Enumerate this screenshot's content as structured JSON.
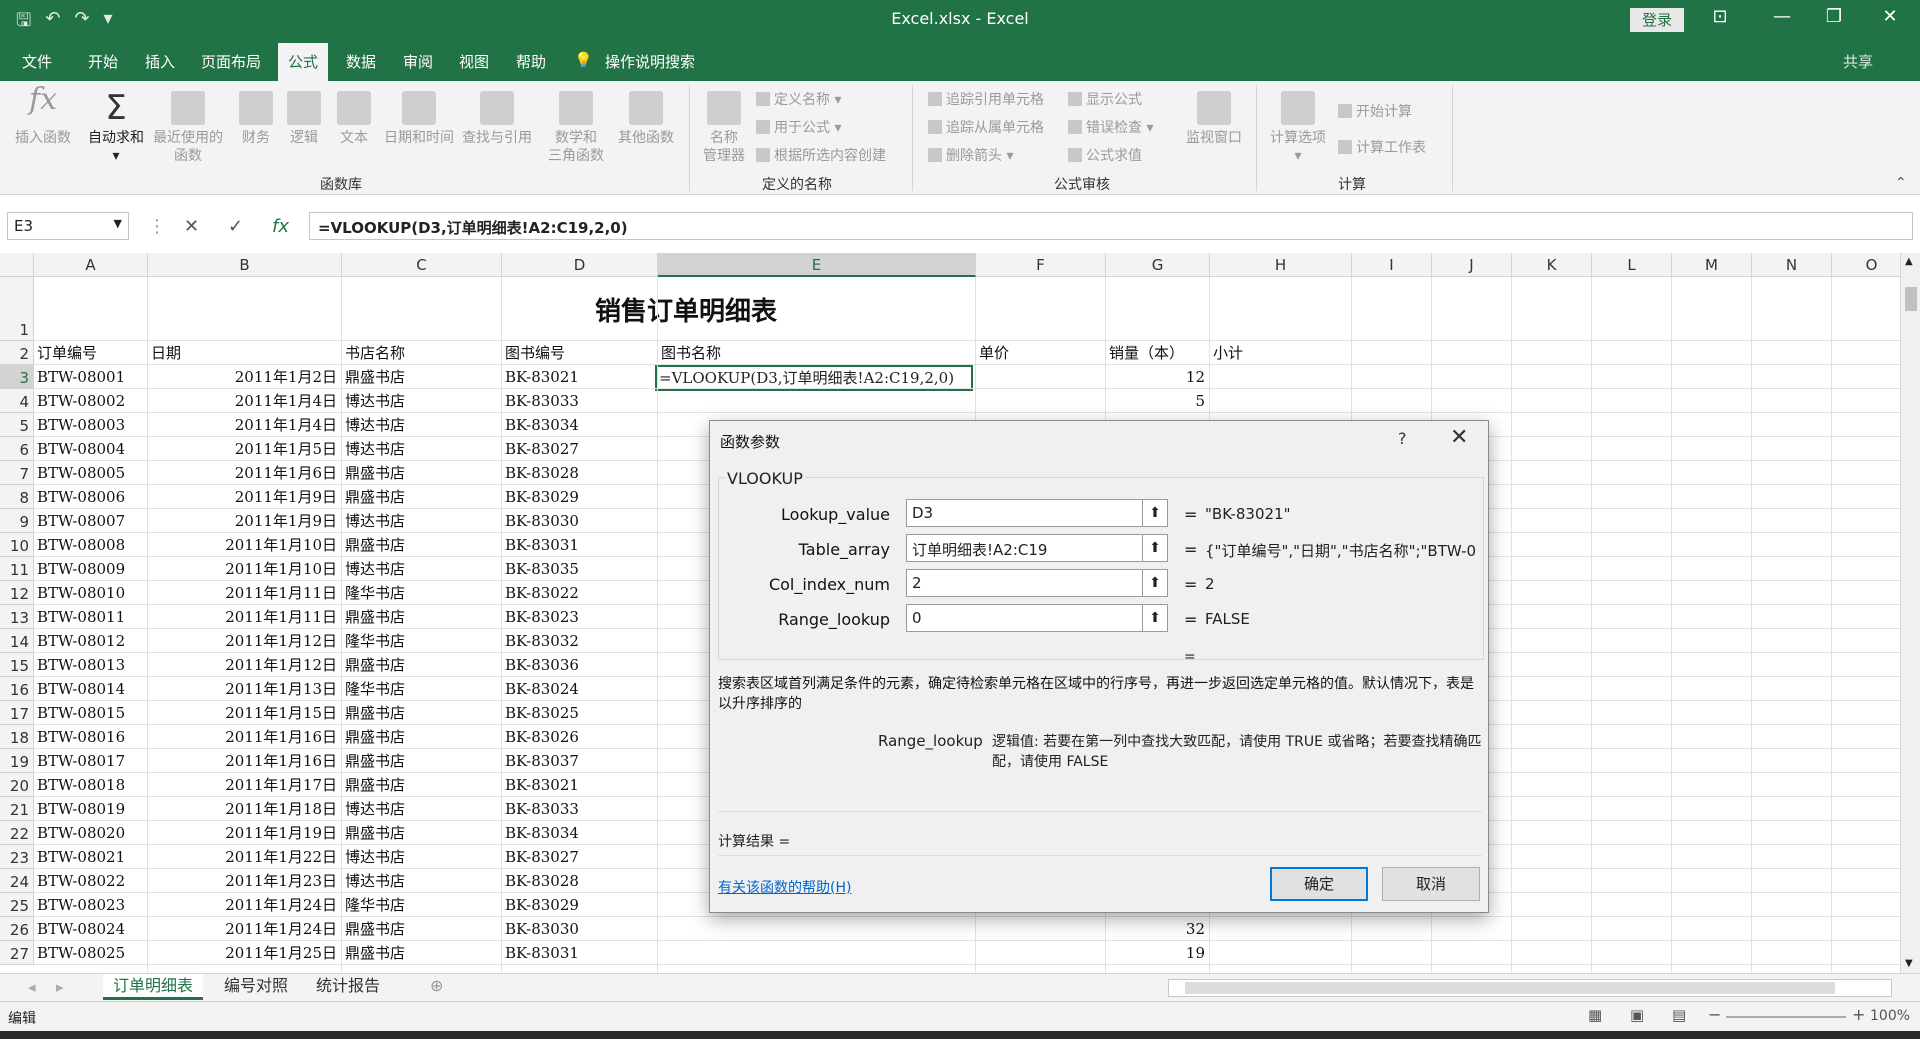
{
  "window": {
    "title": "Excel.xlsx - Excel",
    "login": "登录"
  },
  "tabs": [
    "文件",
    "开始",
    "插入",
    "页面布局",
    "公式",
    "数据",
    "审阅",
    "视图",
    "帮助",
    "操作说明搜索"
  ],
  "share": "共享",
  "ribbon": {
    "insert_fn": "插入函数",
    "autosum": "自动求和",
    "recent": "最近使用的\n函数",
    "finance": "财务",
    "logic": "逻辑",
    "text": "文本",
    "datetime": "日期和时间",
    "lookup": "查找与引用",
    "math": "数学和\n三角函数",
    "more": "其他函数",
    "group_fnlib": "函数库",
    "name_mgr": "名称\n管理器",
    "define_name": "定义名称",
    "use_in_formula": "用于公式",
    "create_from_sel": "根据所选内容创建",
    "group_names": "定义的名称",
    "trace_prec": "追踪引用单元格",
    "trace_dep": "追踪从属单元格",
    "remove_arrows": "删除箭头",
    "show_formulas": "显示公式",
    "error_check": "错误检查",
    "eval_formula": "公式求值",
    "watch": "监视窗口",
    "group_audit": "公式审核",
    "calc_opts": "计算选项",
    "calc_now": "开始计算",
    "calc_sheet": "计算工作表",
    "group_calc": "计算"
  },
  "formula_bar": {
    "name_box": "E3",
    "formula": "=VLOOKUP(D3,订单明细表!A2:C19,2,0)"
  },
  "columns": [
    "A",
    "B",
    "C",
    "D",
    "E",
    "F",
    "G",
    "H",
    "I",
    "J",
    "K",
    "L",
    "M",
    "N",
    "O"
  ],
  "sheet_title": "销售订单明细表",
  "headers": [
    "订单编号",
    "日期",
    "书店名称",
    "图书编号",
    "图书名称",
    "单价",
    "销量（本）",
    "小计"
  ],
  "active_cell_text": "=VLOOKUP(D3,订单明细表!A2:C19,2,0)",
  "rows": [
    {
      "n": "3",
      "a": "BTW-08001",
      "b": "2011年1月2日",
      "c": "鼎盛书店",
      "d": "BK-83021",
      "g": "12"
    },
    {
      "n": "4",
      "a": "BTW-08002",
      "b": "2011年1月4日",
      "c": "博达书店",
      "d": "BK-83033",
      "g": "5"
    },
    {
      "n": "5",
      "a": "BTW-08003",
      "b": "2011年1月4日",
      "c": "博达书店",
      "d": "BK-83034",
      "g": ""
    },
    {
      "n": "6",
      "a": "BTW-08004",
      "b": "2011年1月5日",
      "c": "博达书店",
      "d": "BK-83027",
      "g": ""
    },
    {
      "n": "7",
      "a": "BTW-08005",
      "b": "2011年1月6日",
      "c": "鼎盛书店",
      "d": "BK-83028",
      "g": ""
    },
    {
      "n": "8",
      "a": "BTW-08006",
      "b": "2011年1月9日",
      "c": "鼎盛书店",
      "d": "BK-83029",
      "g": ""
    },
    {
      "n": "9",
      "a": "BTW-08007",
      "b": "2011年1月9日",
      "c": "博达书店",
      "d": "BK-83030",
      "g": ""
    },
    {
      "n": "10",
      "a": "BTW-08008",
      "b": "2011年1月10日",
      "c": "鼎盛书店",
      "d": "BK-83031",
      "g": ""
    },
    {
      "n": "11",
      "a": "BTW-08009",
      "b": "2011年1月10日",
      "c": "博达书店",
      "d": "BK-83035",
      "g": ""
    },
    {
      "n": "12",
      "a": "BTW-08010",
      "b": "2011年1月11日",
      "c": "隆华书店",
      "d": "BK-83022",
      "g": ""
    },
    {
      "n": "13",
      "a": "BTW-08011",
      "b": "2011年1月11日",
      "c": "鼎盛书店",
      "d": "BK-83023",
      "g": ""
    },
    {
      "n": "14",
      "a": "BTW-08012",
      "b": "2011年1月12日",
      "c": "隆华书店",
      "d": "BK-83032",
      "g": ""
    },
    {
      "n": "15",
      "a": "BTW-08013",
      "b": "2011年1月12日",
      "c": "鼎盛书店",
      "d": "BK-83036",
      "g": ""
    },
    {
      "n": "16",
      "a": "BTW-08014",
      "b": "2011年1月13日",
      "c": "隆华书店",
      "d": "BK-83024",
      "g": ""
    },
    {
      "n": "17",
      "a": "BTW-08015",
      "b": "2011年1月15日",
      "c": "鼎盛书店",
      "d": "BK-83025",
      "g": ""
    },
    {
      "n": "18",
      "a": "BTW-08016",
      "b": "2011年1月16日",
      "c": "鼎盛书店",
      "d": "BK-83026",
      "g": ""
    },
    {
      "n": "19",
      "a": "BTW-08017",
      "b": "2011年1月16日",
      "c": "鼎盛书店",
      "d": "BK-83037",
      "g": ""
    },
    {
      "n": "20",
      "a": "BTW-08018",
      "b": "2011年1月17日",
      "c": "鼎盛书店",
      "d": "BK-83021",
      "g": ""
    },
    {
      "n": "21",
      "a": "BTW-08019",
      "b": "2011年1月18日",
      "c": "博达书店",
      "d": "BK-83033",
      "g": ""
    },
    {
      "n": "22",
      "a": "BTW-08020",
      "b": "2011年1月19日",
      "c": "鼎盛书店",
      "d": "BK-83034",
      "g": ""
    },
    {
      "n": "23",
      "a": "BTW-08021",
      "b": "2011年1月22日",
      "c": "博达书店",
      "d": "BK-83027",
      "g": ""
    },
    {
      "n": "24",
      "a": "BTW-08022",
      "b": "2011年1月23日",
      "c": "博达书店",
      "d": "BK-83028",
      "g": ""
    },
    {
      "n": "25",
      "a": "BTW-08023",
      "b": "2011年1月24日",
      "c": "隆华书店",
      "d": "BK-83029",
      "g": ""
    },
    {
      "n": "26",
      "a": "BTW-08024",
      "b": "2011年1月24日",
      "c": "鼎盛书店",
      "d": "BK-83030",
      "g": "32"
    },
    {
      "n": "27",
      "a": "BTW-08025",
      "b": "2011年1月25日",
      "c": "鼎盛书店",
      "d": "BK-83031",
      "g": "19"
    }
  ],
  "dialog": {
    "title": "函数参数",
    "help_q": "?",
    "function": "VLOOKUP",
    "args": [
      {
        "label": "Lookup_value",
        "value": "D3",
        "result": "\"BK-83021\""
      },
      {
        "label": "Table_array",
        "value": "订单明细表!A2:C19",
        "result": "{\"订单编号\",\"日期\",\"书店名称\";\"BTW-0"
      },
      {
        "label": "Col_index_num",
        "value": "2",
        "result": "2"
      },
      {
        "label": "Range_lookup",
        "value": "0",
        "result": "FALSE"
      }
    ],
    "eq": "=",
    "description": "搜索表区域首列满足条件的元素，确定待检索单元格在区域中的行序号，再进一步返回选定单元格的值。默认情况下，表是以升序排序的",
    "arg_name": "Range_lookup",
    "arg_desc": "逻辑值: 若要在第一列中查找大致匹配，请使用 TRUE 或省略；若要查找精确匹配，请使用 FALSE",
    "calc_result": "计算结果 =",
    "help_link": "有关该函数的帮助(H)",
    "ok": "确定",
    "cancel": "取消"
  },
  "sheets": [
    "订单明细表",
    "编号对照",
    "统计报告"
  ],
  "status": {
    "mode": "编辑",
    "zoom": "100%"
  }
}
